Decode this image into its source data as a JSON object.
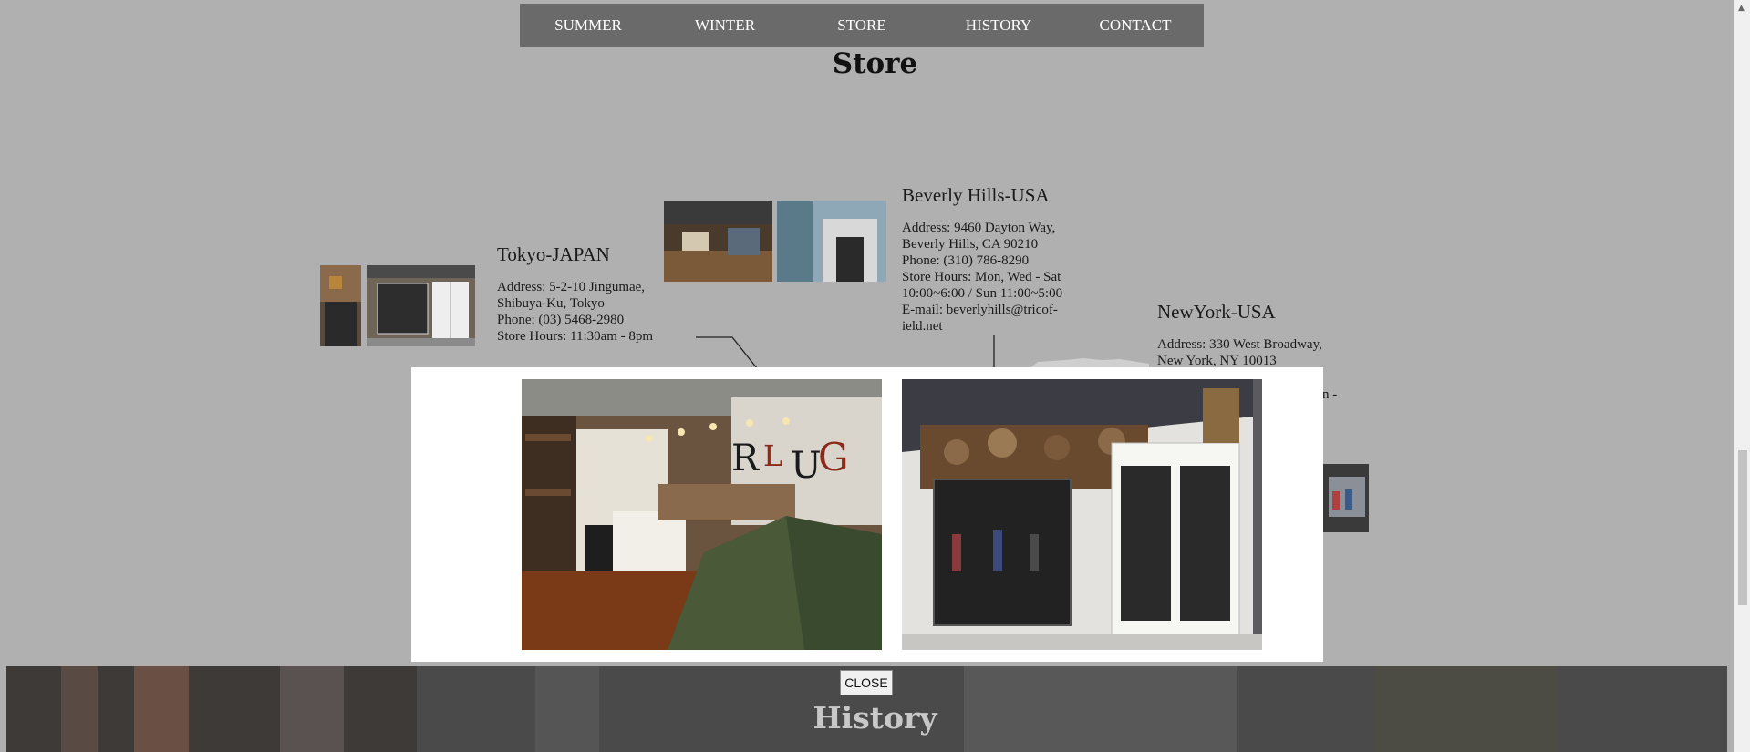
{
  "nav": {
    "items": [
      {
        "label": "SUMMER"
      },
      {
        "label": "WINTER"
      },
      {
        "label": "STORE"
      },
      {
        "label": "HISTORY"
      },
      {
        "label": "CONTACT"
      }
    ]
  },
  "page_title": "Store",
  "stores": {
    "tokyo": {
      "name": "Tokyo-JAPAN",
      "lines": [
        "Address: 5-2-10 Jingumae,",
        "Shibuya-Ku, Tokyo",
        "Phone: (03) 5468-2980",
        "Store Hours: 11:30am - 8pm"
      ]
    },
    "beverly": {
      "name": "Beverly Hills-USA",
      "lines": [
        "Address: 9460 Dayton Way,",
        "Beverly Hills, CA 90210",
        "Phone: (310) 786-8290",
        "Store Hours: Mon, Wed - Sat",
        "10:00~6:00 / Sun 11:00~5:00",
        "E-mail: beverlyhills@tricof-",
        "ield.net"
      ]
    },
    "newyork": {
      "name": "NewYork-USA",
      "lines": [
        "Address: 330 West Broadway,",
        "New York, NY 10013"
      ],
      "partial": "n -"
    }
  },
  "modal": {
    "images": [
      "store-interior-photo",
      "storefront-photo"
    ]
  },
  "close_label": "CLOSE",
  "history_title": "History",
  "colors": {
    "overlay": "#b0b0b0",
    "nav_bg": "#6a6a6a",
    "modal_bg": "#ffffff"
  }
}
